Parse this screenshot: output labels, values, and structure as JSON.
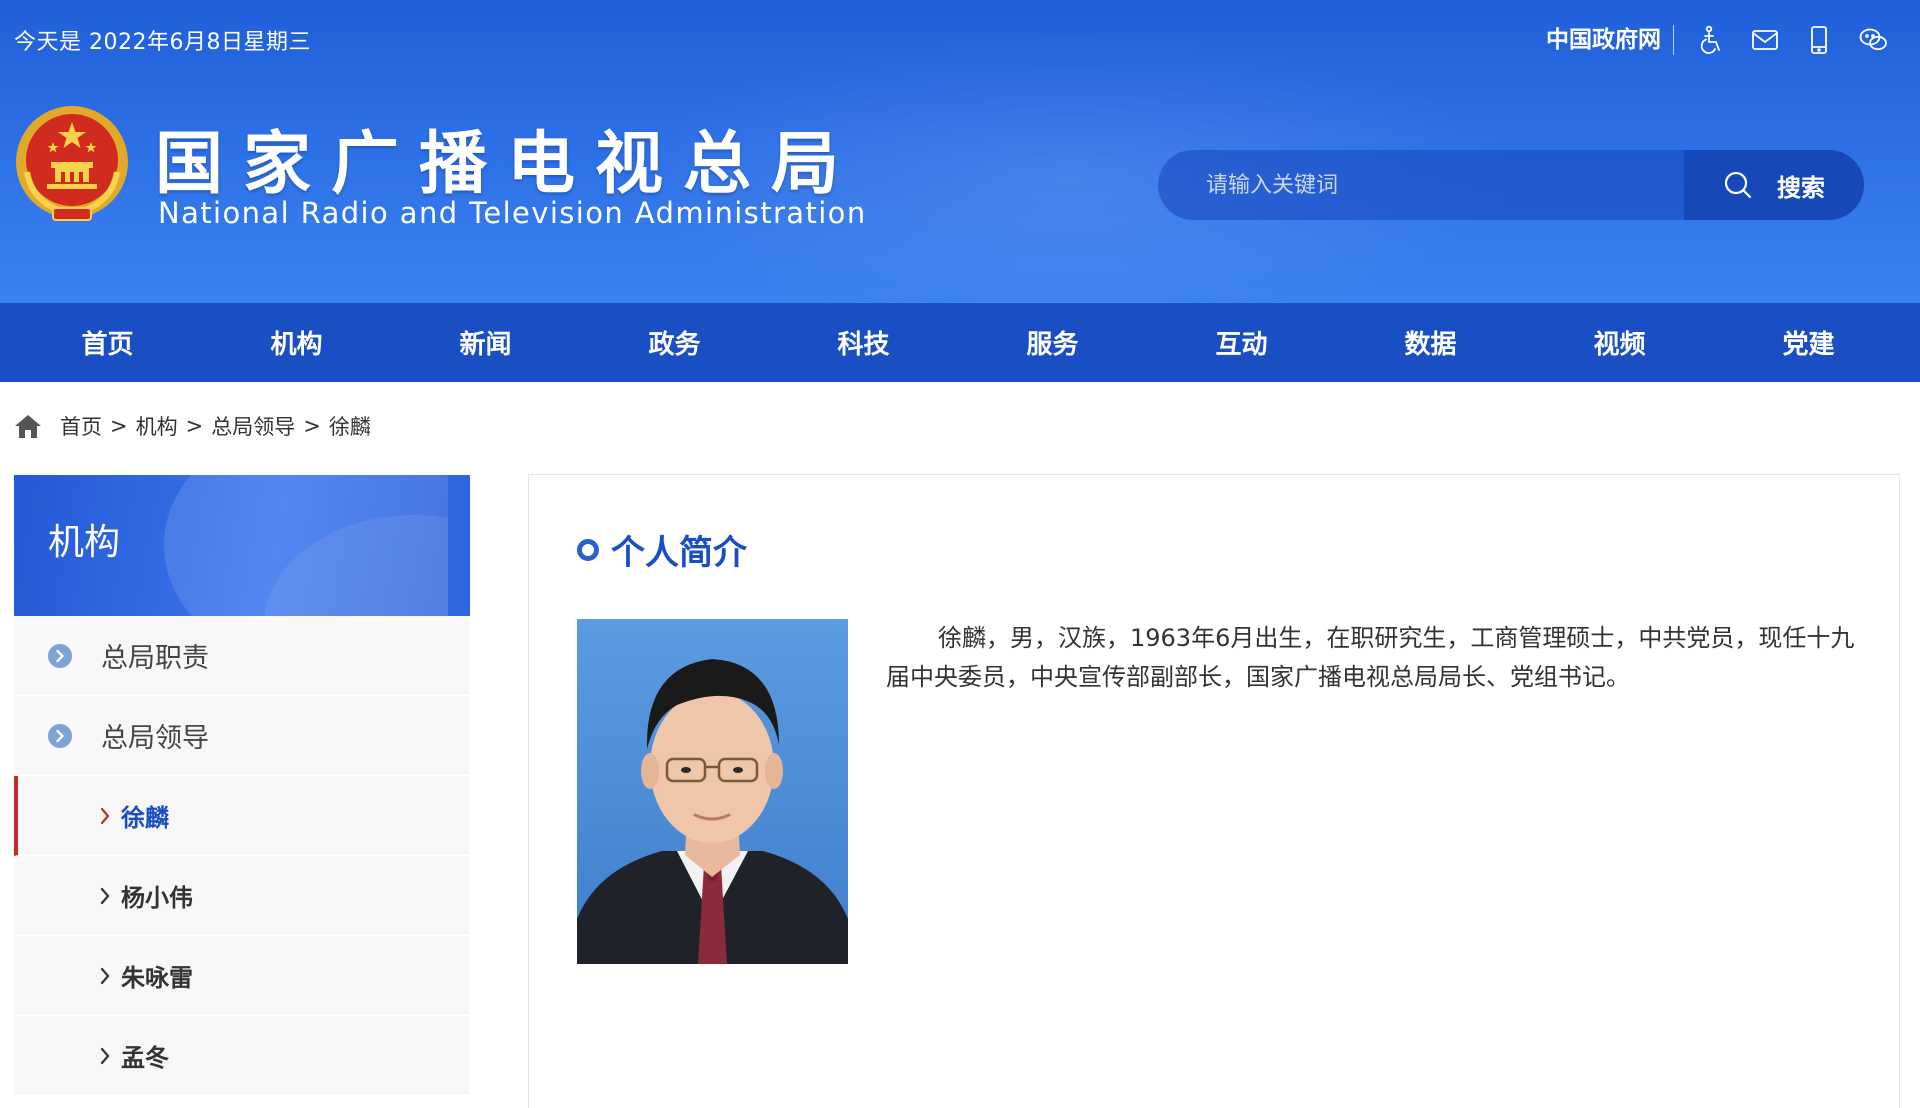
{
  "header": {
    "date": "今天是 2022年6月8日星期三",
    "gov_link": "中国政府网",
    "icons": [
      "accessibility-icon",
      "mail-icon",
      "mobile-icon",
      "wechat-icon"
    ],
    "title_cn": "国家广播电视总局",
    "title_en": "National Radio and Television Administration",
    "emblem": "national-emblem-icon"
  },
  "search": {
    "placeholder": "请输入关键词",
    "button_label": "搜索"
  },
  "nav": {
    "items": [
      "首页",
      "机构",
      "新闻",
      "政务",
      "科技",
      "服务",
      "互动",
      "数据",
      "视频",
      "党建"
    ]
  },
  "breadcrumb": {
    "items": [
      "首页",
      "机构",
      "总局领导",
      "徐麟"
    ],
    "separator": ">"
  },
  "sidebar": {
    "title": "机构",
    "sections": [
      "总局职责",
      "总局领导"
    ],
    "leaders": [
      "徐麟",
      "杨小伟",
      "朱咏雷",
      "孟冬"
    ],
    "active_leader": "徐麟"
  },
  "content": {
    "section_title": "个人简介",
    "bio": "徐麟，男，汉族，1963年6月出生，在职研究生，工商管理硕士，中共党员，现任十九届中央委员，中央宣传部副部长，国家广播电视总局局长、党组书记。"
  },
  "colors": {
    "header_blue": "#2c6fe6",
    "nav_blue": "#1a4fc4",
    "active_red": "#c9252b",
    "accent_blue": "#1a4fc4"
  }
}
